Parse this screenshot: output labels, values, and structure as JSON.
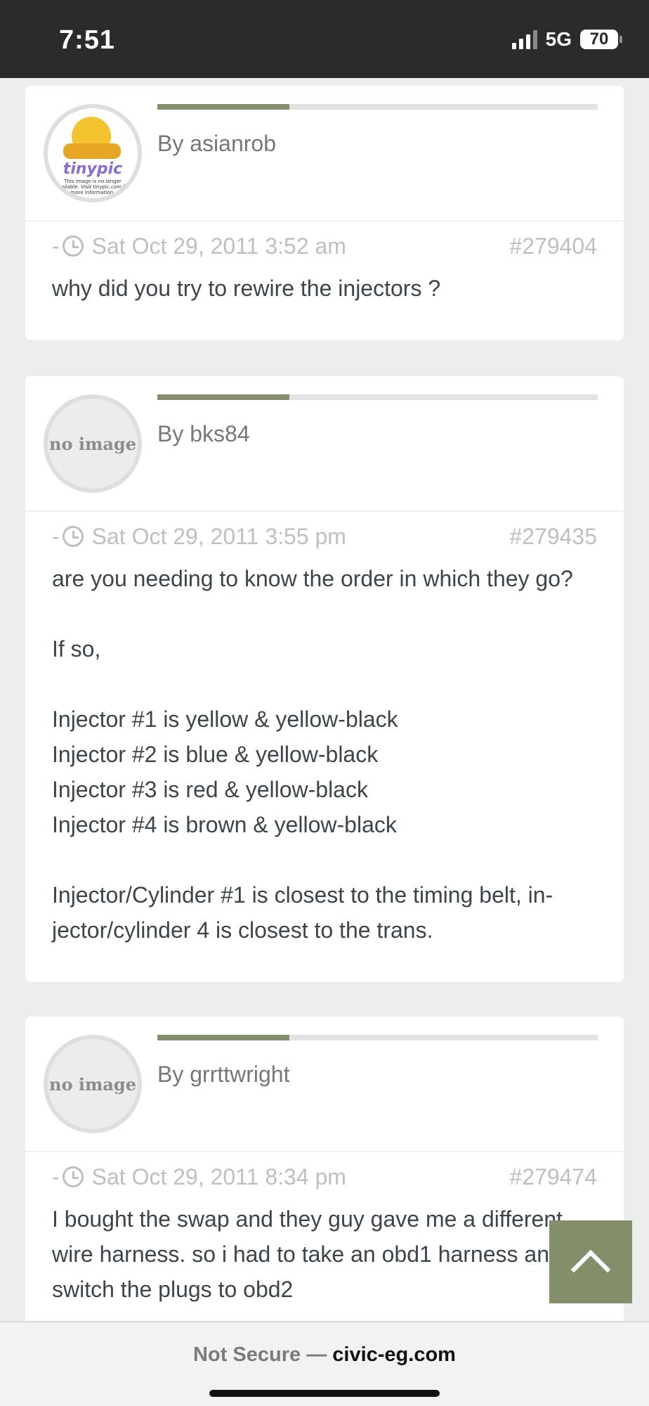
{
  "status": {
    "time": "7:51",
    "network": "5G",
    "battery": "70"
  },
  "posts": [
    {
      "author": "By asianrob",
      "avatar": {
        "type": "image",
        "brand": "tinypic",
        "note": "This image is no longer available. Visit tinypic.com for more information."
      },
      "meta_sep": "-",
      "date": "Sat Oct 29, 2011 3:52 am",
      "id": "#279404",
      "reputation": 0.3,
      "lines": [
        "why did you try to rewire the injectors ?"
      ]
    },
    {
      "author": "By bks84",
      "avatar": {
        "type": "placeholder",
        "text": "no image"
      },
      "meta_sep": "-",
      "date": "Sat Oct 29, 2011 3:55 pm",
      "id": "#279435",
      "reputation": 0.3,
      "lines": [
        "are you needing to know the order in which they go?",
        "",
        "If so,",
        "",
        "Injector #1 is yellow & yellow-black",
        "Injector #2 is blue & yellow-black",
        "Injector #3 is red & yellow-black",
        "Injector #4 is brown & yellow-black",
        "",
        "Injector/Cylinder #1 is closest to the timing belt, in-",
        "jector/cylinder 4 is closest to the trans."
      ]
    },
    {
      "author": "By grrttwright",
      "avatar": {
        "type": "placeholder",
        "text": "no image"
      },
      "meta_sep": "-",
      "date": "Sat Oct 29, 2011 8:34 pm",
      "id": "#279474",
      "reputation": 0.3,
      "lines": [
        "I bought the swap and they guy gave me a different",
        "wire harness. so i had to take an obd1 harness and",
        "switch the plugs to obd2"
      ]
    }
  ],
  "browser": {
    "not_secure": "Not Secure —",
    "domain": "civic-eg.com"
  },
  "colors": {
    "accent": "#838e6b",
    "status_bar": "#2b2b2b",
    "page_bg": "#eceeee"
  }
}
